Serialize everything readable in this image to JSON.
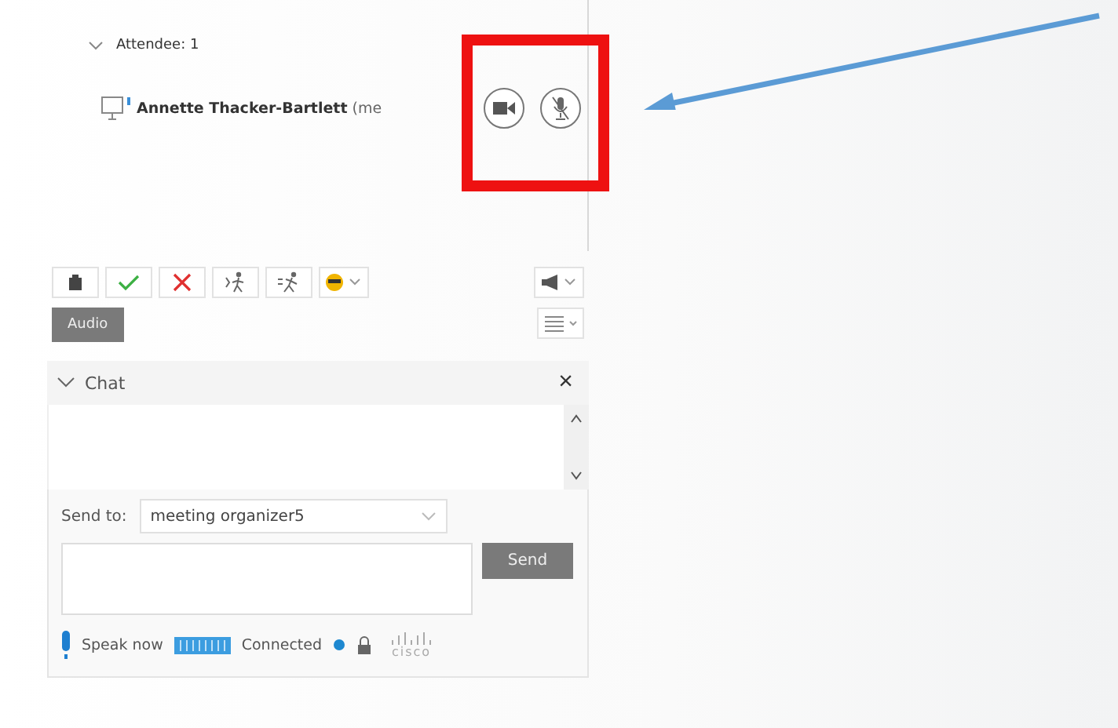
{
  "attendees": {
    "header": "Attendee: 1",
    "expanded": true,
    "people": [
      {
        "name": "Annette Thacker-Bartlett",
        "suffix": "(me"
      }
    ]
  },
  "toolbar": {
    "audio_button": "Audio"
  },
  "chat": {
    "title": "Chat",
    "close": "×",
    "send_to_label": "Send to:",
    "recipient": "meeting organizer5",
    "send_button": "Send"
  },
  "status_bar": {
    "speak": "Speak now",
    "connection": "Connected",
    "logo": "cisco"
  }
}
